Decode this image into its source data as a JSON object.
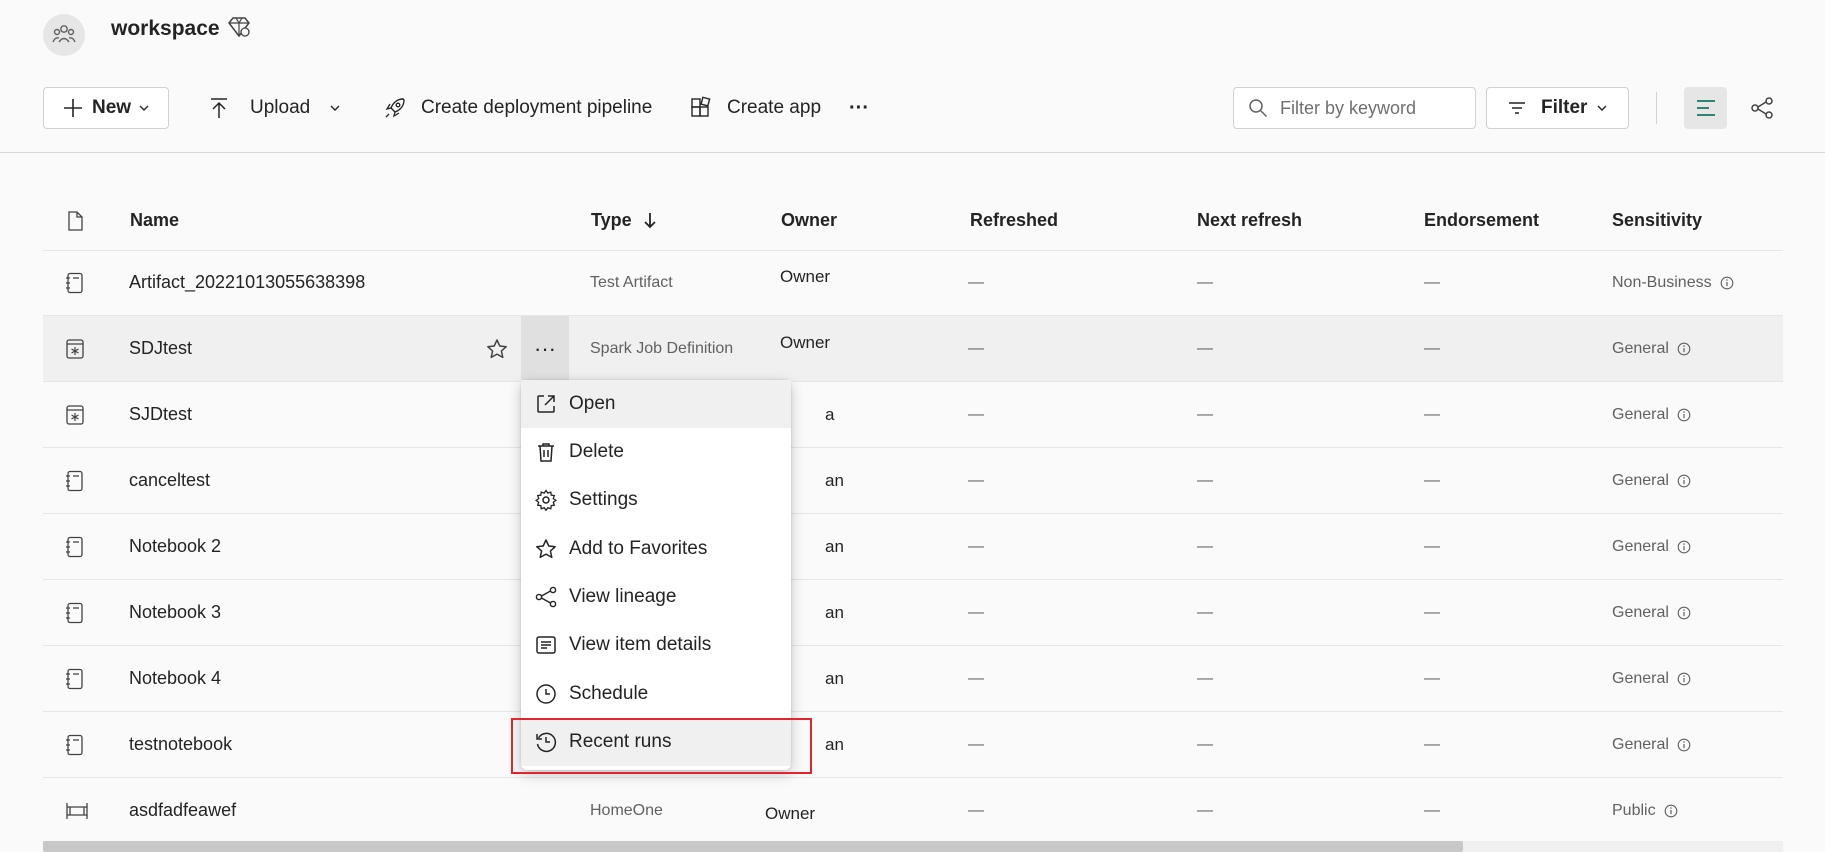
{
  "workspace": {
    "title": "workspace"
  },
  "toolbar": {
    "new_label": "New",
    "upload_label": "Upload",
    "pipeline_label": "Create deployment pipeline",
    "app_label": "Create app",
    "more_label": "···",
    "search_placeholder": "Filter by keyword",
    "filter_label": "Filter"
  },
  "table": {
    "headers": {
      "name": "Name",
      "type": "Type",
      "owner": "Owner",
      "refreshed": "Refreshed",
      "next_refresh": "Next refresh",
      "endorsement": "Endorsement",
      "sensitivity": "Sensitivity"
    },
    "rows": [
      {
        "icon": "notebook-icon",
        "name": "Artifact_20221013055638398",
        "type": "Test Artifact",
        "owner": "Owner",
        "refreshed": "—",
        "next_refresh": "—",
        "endorsement": "—",
        "sensitivity": "Non-Business"
      },
      {
        "icon": "spark-job-icon",
        "name": "SDJtest",
        "type": "Spark Job Definition",
        "owner": "Owner",
        "refreshed": "—",
        "next_refresh": "—",
        "endorsement": "—",
        "sensitivity": "General"
      },
      {
        "icon": "spark-job-icon",
        "name": "SJDtest",
        "type": "",
        "owner": "a",
        "refreshed": "—",
        "next_refresh": "—",
        "endorsement": "—",
        "sensitivity": "General"
      },
      {
        "icon": "notebook-icon",
        "name": "canceltest",
        "type": "",
        "owner": "an",
        "refreshed": "—",
        "next_refresh": "—",
        "endorsement": "—",
        "sensitivity": "General"
      },
      {
        "icon": "notebook-icon",
        "name": "Notebook 2",
        "type": "",
        "owner": "an",
        "refreshed": "—",
        "next_refresh": "—",
        "endorsement": "—",
        "sensitivity": "General"
      },
      {
        "icon": "notebook-icon",
        "name": "Notebook 3",
        "type": "",
        "owner": "an",
        "refreshed": "—",
        "next_refresh": "—",
        "endorsement": "—",
        "sensitivity": "General"
      },
      {
        "icon": "notebook-icon",
        "name": "Notebook 4",
        "type": "",
        "owner": "an",
        "refreshed": "—",
        "next_refresh": "—",
        "endorsement": "—",
        "sensitivity": "General"
      },
      {
        "icon": "notebook-icon",
        "name": "testnotebook",
        "type": "",
        "owner": "an",
        "refreshed": "—",
        "next_refresh": "—",
        "endorsement": "—",
        "sensitivity": "General"
      },
      {
        "icon": "pipeline-item-icon",
        "name": "asdfadfeawef",
        "type": "HomeOne",
        "owner": "Owner",
        "refreshed": "—",
        "next_refresh": "—",
        "endorsement": "—",
        "sensitivity": "Public"
      }
    ]
  },
  "context_menu": {
    "items": [
      {
        "label": "Open",
        "icon": "open-external-icon"
      },
      {
        "label": "Delete",
        "icon": "trash-icon"
      },
      {
        "label": "Settings",
        "icon": "gear-icon"
      },
      {
        "label": "Add to Favorites",
        "icon": "star-icon"
      },
      {
        "label": "View lineage",
        "icon": "lineage-icon"
      },
      {
        "label": "View item details",
        "icon": "details-icon"
      },
      {
        "label": "Schedule",
        "icon": "clock-icon"
      },
      {
        "label": "Recent runs",
        "icon": "history-icon"
      }
    ]
  },
  "more_button_label": "···",
  "colors": {
    "accent": "#117865",
    "highlight": "#e3262e"
  }
}
